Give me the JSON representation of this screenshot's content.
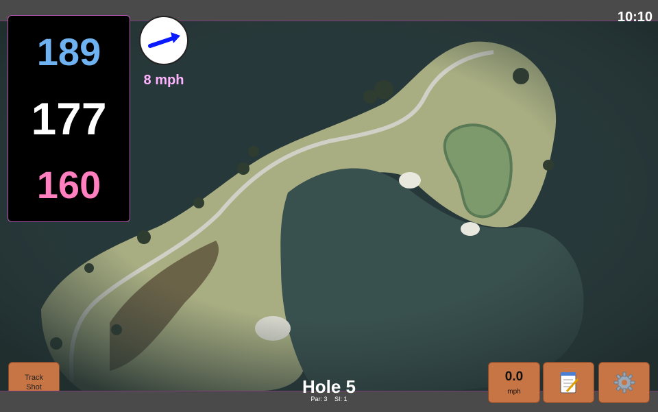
{
  "status": {
    "time": "10:10"
  },
  "distances": {
    "back": "189",
    "middle": "177",
    "front": "160"
  },
  "wind": {
    "speed_label": "8 mph",
    "icon": "wind-direction-arrow-icon"
  },
  "buttons": {
    "track_shot": "Track\nShot",
    "speed_value": "0.0",
    "speed_unit": "mph",
    "notes_icon": "notepad-icon",
    "settings_icon": "gear-icon"
  },
  "hole": {
    "title": "Hole 5",
    "par": "Par: 3",
    "si": "SI: 1"
  },
  "colors": {
    "back": "#6fb2f2",
    "middle": "#ffffff",
    "front": "#ff7fbf",
    "button": "#c87545",
    "wind_text": "#ffb3ff"
  }
}
